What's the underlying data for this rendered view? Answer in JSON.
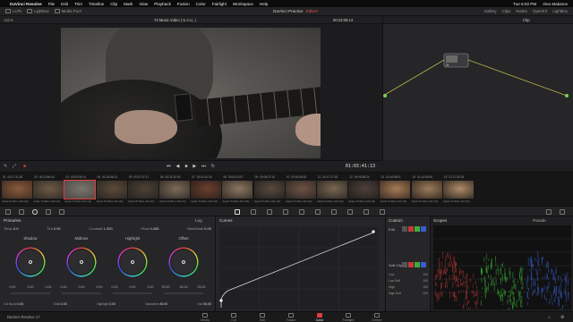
{
  "menubar": {
    "app": "DaVinci Resolve",
    "items": [
      "File",
      "Edit",
      "Trim",
      "Timeline",
      "Clip",
      "Mark",
      "View",
      "Playback",
      "Fusion",
      "Color",
      "Fairlight",
      "Workspace",
      "Help"
    ],
    "user": "Alex Makarov",
    "clock": "Tue 6:02 PM"
  },
  "toolbar": {
    "items": [
      "LUTs",
      "Lightbox",
      "Media Pool"
    ],
    "project_title": "DaVinci Practice",
    "edited": "Edited",
    "right_items": [
      "Gallery",
      "Clips",
      "Nodes",
      "OpenFX",
      "Lightbox"
    ]
  },
  "viewer": {
    "zoom": "131%",
    "title": "73 Music Video ( S.A.U. )",
    "timecode_top": "00:23:06:14",
    "timecode": "01:03:41:13"
  },
  "nodes": {
    "header": "Clip",
    "node_label": "01"
  },
  "clips": [
    {
      "num": "01",
      "tc": "00:17:11:26",
      "tr": "V1",
      "name": "Apple ProRes 422 HQ",
      "active": false,
      "c1": "#3a2a22",
      "c2": "#8a5a3a"
    },
    {
      "num": "02",
      "tc": "00:23:46:16",
      "tr": "V1",
      "name": "Apple ProRes 422 HQ",
      "active": false,
      "c1": "#2d2a26",
      "c2": "#6e5a44"
    },
    {
      "num": "03",
      "tc": "00:23:06:14",
      "tr": "V1",
      "name": "Apple ProRes 422 HQ",
      "active": true,
      "c1": "#4a4743",
      "c2": "#7a756d"
    },
    {
      "num": "04",
      "tc": "01:15:06:13",
      "tr": "V1",
      "name": "Apple ProRes 422 HQ",
      "active": false,
      "c1": "#2a2622",
      "c2": "#5c4a38"
    },
    {
      "num": "05",
      "tc": "00:07:37:17",
      "tr": "V1",
      "name": "Apple ProRes 422 HQ",
      "active": false,
      "c1": "#23221f",
      "c2": "#4d4236"
    },
    {
      "num": "06",
      "tc": "00:31:30:03",
      "tr": "V1",
      "name": "Apple ProRes 422 HQ",
      "active": false,
      "c1": "#2f2b28",
      "c2": "#7d6a57"
    },
    {
      "num": "07",
      "tc": "01:01:41:18",
      "tr": "V1",
      "name": "Apple ProRes 422 HQ",
      "active": false,
      "c1": "#2a1f1b",
      "c2": "#6b3e2e"
    },
    {
      "num": "08",
      "tc": "00:04:22:07",
      "tr": "V1",
      "name": "Apple ProRes 422 HQ",
      "active": false,
      "c1": "#322c26",
      "c2": "#8b7762"
    },
    {
      "num": "09",
      "tc": "00:06:27:14",
      "tr": "V1",
      "name": "Apple ProRes 422 HQ",
      "active": false,
      "c1": "#211f1d",
      "c2": "#594a3d"
    },
    {
      "num": "10",
      "tc": "00:16:55:15",
      "tr": "V1",
      "name": "Apple ProRes 422 HQ",
      "active": false,
      "c1": "#2b2624",
      "c2": "#6f5245"
    },
    {
      "num": "11",
      "tc": "00:17:17:18",
      "tr": "V1",
      "name": "Apple ProRes 422 HQ",
      "active": false,
      "c1": "#2a2723",
      "c2": "#7a6651"
    },
    {
      "num": "12",
      "tc": "00:08:38:24",
      "tr": "V1",
      "name": "Apple ProRes 422 HQ",
      "active": false,
      "c1": "#1f1d1c",
      "c2": "#4f4139"
    },
    {
      "num": "13",
      "tc": "01:34:06:01",
      "tr": "V1",
      "name": "Apple ProRes 422 HQ",
      "active": false,
      "c1": "#3a2c23",
      "c2": "#a57a55"
    },
    {
      "num": "14",
      "tc": "01:14:05:06",
      "tr": "V1",
      "name": "Apple ProRes 422 HQ",
      "active": false,
      "c1": "#33291f",
      "c2": "#9b7a5a"
    },
    {
      "num": "15",
      "tc": "01:17:51:03",
      "tr": "V1",
      "name": "Apple ProRes 422 HQ",
      "active": false,
      "c1": "#2c2622",
      "c2": "#b08a66"
    }
  ],
  "primaries": {
    "title": "Primaries",
    "mode": "Log",
    "params": [
      {
        "label": "Temp",
        "value": "0.0"
      },
      {
        "label": "Tint",
        "value": "0.00"
      },
      {
        "label": "Contrast",
        "value": "1.000"
      },
      {
        "label": "Pivot",
        "value": "0.435"
      },
      {
        "label": "Mid/Detail",
        "value": "0.00"
      }
    ],
    "wheels": [
      {
        "label": "Shadow",
        "vals": [
          "0.00",
          "0.00",
          "0.00"
        ]
      },
      {
        "label": "Midtone",
        "vals": [
          "0.00",
          "0.00",
          "0.00"
        ]
      },
      {
        "label": "Highlight",
        "vals": [
          "0.00",
          "0.00",
          "0.00"
        ]
      },
      {
        "label": "Offset",
        "vals": [
          "25.00",
          "25.00",
          "25.00"
        ]
      }
    ],
    "footer": [
      {
        "label": "Col Boost",
        "value": "0.00"
      },
      {
        "label": "Shad",
        "value": "0.00"
      },
      {
        "label": "Highlight",
        "value": "0.00"
      },
      {
        "label": "Saturation",
        "value": "50.00"
      },
      {
        "label": "Hue",
        "value": "50.00"
      }
    ]
  },
  "curves": {
    "title": "Curves"
  },
  "custom": {
    "title": "Custom",
    "edit_label": "Edit",
    "soft_clip": "Soft Clip",
    "rows": [
      "Low",
      "Low Soft",
      "High",
      "High Soft"
    ],
    "values": [
      "100",
      "100",
      "100",
      "100"
    ]
  },
  "scopes": {
    "title": "Scopes",
    "mode": "Parade"
  },
  "tabs": [
    "Media",
    "Cut",
    "Edit",
    "Fusion",
    "Color",
    "Fairlight",
    "Deliver"
  ],
  "active_tab": "Color",
  "footer_app": "DaVinci Resolve 17"
}
